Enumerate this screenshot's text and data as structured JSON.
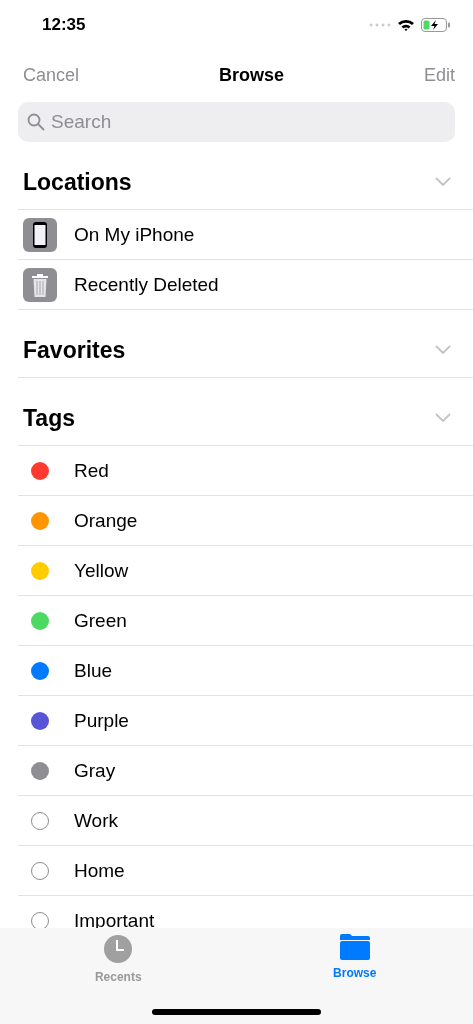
{
  "status_bar": {
    "time": "12:35"
  },
  "nav": {
    "left": "Cancel",
    "title": "Browse",
    "right": "Edit"
  },
  "search": {
    "placeholder": "Search"
  },
  "sections": [
    {
      "title": "Locations",
      "items": [
        {
          "label": "On My iPhone",
          "kind": "phone"
        },
        {
          "label": "Recently Deleted",
          "kind": "trash"
        }
      ]
    },
    {
      "title": "Favorites"
    },
    {
      "title": "Tags",
      "items": [
        {
          "label": "Red",
          "kind": "tag",
          "color": "#ff3b30"
        },
        {
          "label": "Orange",
          "kind": "tag",
          "color": "#ff9500"
        },
        {
          "label": "Yellow",
          "kind": "tag",
          "color": "#ffcc00"
        },
        {
          "label": "Green",
          "kind": "tag",
          "color": "#4cd964"
        },
        {
          "label": "Blue",
          "kind": "tag",
          "color": "#007aff"
        },
        {
          "label": "Purple",
          "kind": "tag",
          "color": "#5856d6"
        },
        {
          "label": "Gray",
          "kind": "tag",
          "color": "#8e8e93"
        },
        {
          "label": "Work",
          "kind": "tag"
        },
        {
          "label": "Home",
          "kind": "tag"
        },
        {
          "label": "Important",
          "kind": "tag"
        }
      ]
    }
  ],
  "tab_bar": [
    {
      "label": "Recents",
      "kind": "clock",
      "selected": false
    },
    {
      "label": "Browse",
      "kind": "folder",
      "selected": true
    }
  ]
}
